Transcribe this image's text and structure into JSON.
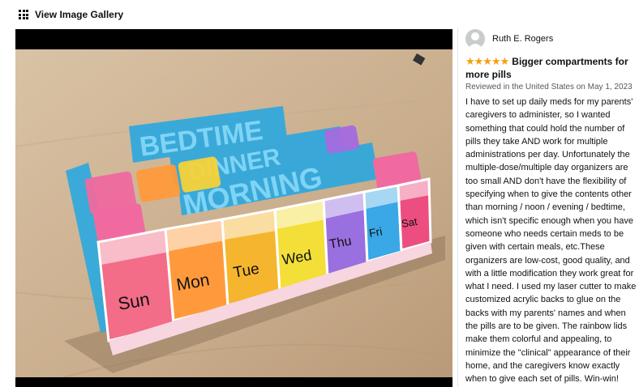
{
  "gallery": {
    "label": "View Image Gallery"
  },
  "photo": {
    "day_labels": [
      "Sun",
      "Mon",
      "Tue",
      "Wed",
      "Thu",
      "Fri",
      "Sat"
    ],
    "sign_labels": [
      "BEDTIME",
      "DINNER",
      "MORNING"
    ]
  },
  "review": {
    "reviewer_name": "Ruth E. Rogers",
    "rating": "5 out of 5 stars",
    "stars": "★★★★★",
    "title": "Bigger compartments for more pills",
    "date": "Reviewed in the United States on May 1, 2023",
    "body": "I have to set up daily meds for my parents' caregivers to administer, so I wanted something that could hold the number of pills they take AND work for multiple administrations per day. Unfortunately the multiple-dose/multiple day organizers are too small AND don't have the flexibility of specifying when to give the contents other than morning / noon / evening / bedtime, which isn't specific enough when you have someone who needs certain meds to be given with certain meals, etc.These organizers are low-cost, good quality, and with a little modification they work great for what I need. I used my laser cutter to make customized acrylic backs to glue on the backs with my parents' names and when the pills are to be given. The rainbow lids make them colorful and appealing, to minimize the \"clinical\" appearance of their home, and the caregivers know exactly when to give each set of pills. Win-win!"
  },
  "colors": {
    "star": "#f59e0b",
    "sign_blue": "#2aa8e0",
    "table": "#cdb497"
  }
}
